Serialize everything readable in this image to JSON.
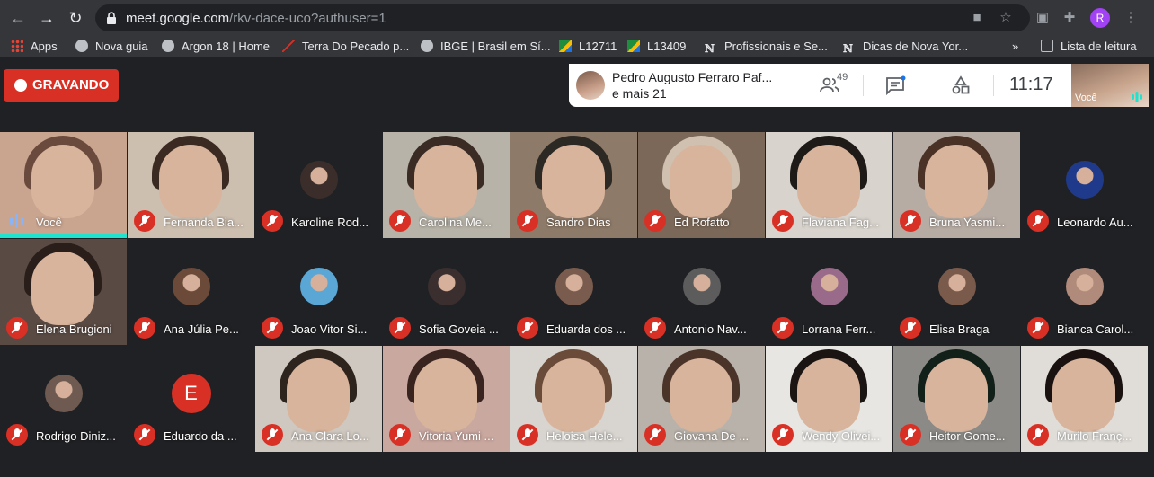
{
  "browser": {
    "url_host": "meet.google.com",
    "url_rest": "/rkv-dace-uco?authuser=1",
    "profile_initial": "R",
    "bookmarks": [
      "Apps",
      "Nova guia",
      "Argon 18 | Home",
      "Terra Do Pecado p...",
      "IBGE | Brasil em Sí...",
      "L12711",
      "L13409",
      "Profissionais e Se...",
      "Dicas de Nova Yor..."
    ],
    "more": "»",
    "reading_list": "Lista de leitura"
  },
  "meet": {
    "recording_label": "GRAVANDO",
    "presenter_name": "Pedro Augusto Ferraro Paf...",
    "presenter_more": "e mais 21",
    "participant_count": "49",
    "clock": "11:17",
    "self_label": "Você",
    "accent": "#d93025"
  },
  "participants": [
    "Você",
    "Fernanda Bia...",
    "Karoline Rod...",
    "Carolina Me...",
    "Sandro Dias",
    "Ed Rofatto",
    "Flaviana Fag...",
    "Bruna Yasmi...",
    "Leonardo Au...",
    "Elena Brugioni",
    "Ana Júlia Pe...",
    "Joao Vitor Si...",
    "Sofia Goveia ...",
    "Eduarda dos ...",
    "Antonio Nav...",
    "Lorrana Ferr...",
    "Elisa Braga",
    "Bianca Carol...",
    "Rodrigo Diniz...",
    "Eduardo da ...",
    "Ana Clara Lo...",
    "Vitoria Yumi ...",
    "Heloisa Hele...",
    "Giovana De ...",
    "Wendy Olivei...",
    "Heitor Gome...",
    "Murilo Franç..."
  ],
  "letter_avatar": "E"
}
